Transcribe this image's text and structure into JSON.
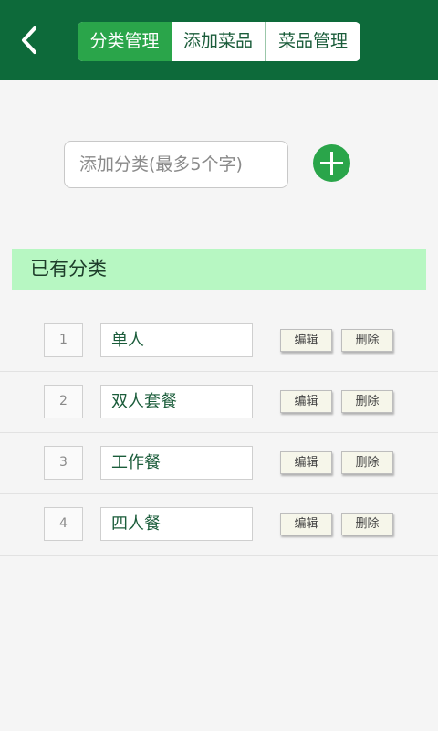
{
  "header": {
    "back_icon": "chevron-left-icon",
    "tabs": [
      {
        "label": "分类管理",
        "active": true
      },
      {
        "label": "添加菜品",
        "active": false
      },
      {
        "label": "菜品管理",
        "active": false
      }
    ]
  },
  "add_category": {
    "placeholder": "添加分类(最多5个字)",
    "value": "",
    "add_icon": "plus-icon"
  },
  "section": {
    "title": "已有分类"
  },
  "categories": [
    {
      "index": "1",
      "name": "单人",
      "edit_label": "编辑",
      "delete_label": "删除"
    },
    {
      "index": "2",
      "name": "双人套餐",
      "edit_label": "编辑",
      "delete_label": "删除"
    },
    {
      "index": "3",
      "name": "工作餐",
      "edit_label": "编辑",
      "delete_label": "删除"
    },
    {
      "index": "4",
      "name": "四人餐",
      "edit_label": "编辑",
      "delete_label": "删除"
    }
  ],
  "colors": {
    "header_bg": "#0d6a3a",
    "accent": "#2aa54a",
    "section_bg": "#b7f7c2",
    "page_bg": "#f5f5f5"
  }
}
